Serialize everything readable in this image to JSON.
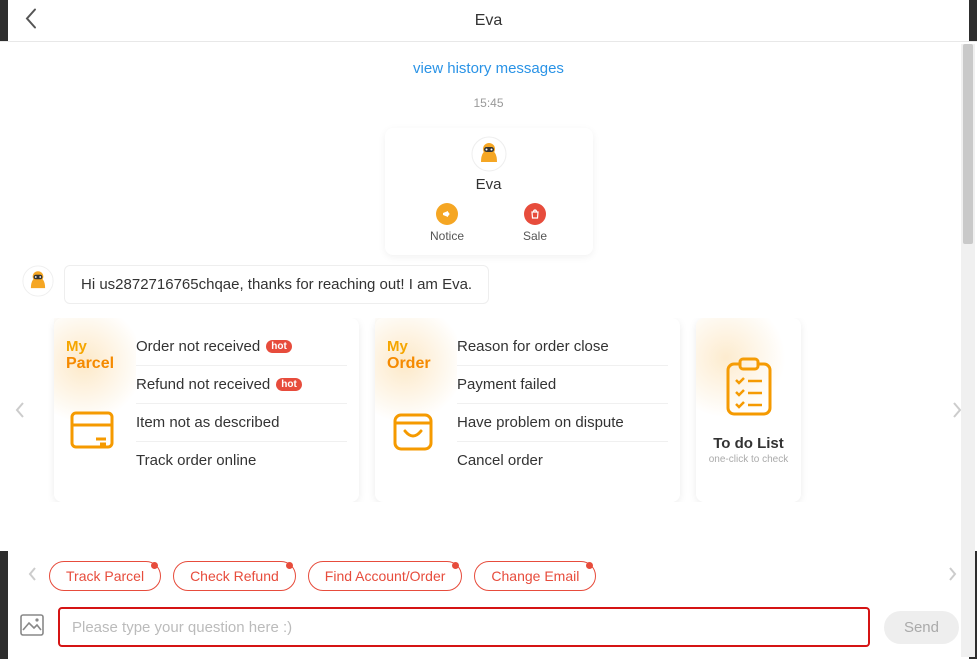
{
  "header": {
    "title": "Eva"
  },
  "history_link": "view history messages",
  "timestamp": "15:45",
  "bot": {
    "name": "Eva",
    "actions": [
      {
        "label": "Notice",
        "icon": "megaphone",
        "color": "orange"
      },
      {
        "label": "Sale",
        "icon": "bag",
        "color": "red"
      }
    ]
  },
  "greeting": "Hi us2872716765chqae, thanks for reaching out! I am Eva.",
  "help_cards": [
    {
      "category_line1": "My",
      "category_line2": "Parcel",
      "icon": "parcel-box",
      "items": [
        {
          "label": "Order not received",
          "hot": true
        },
        {
          "label": "Refund not received",
          "hot": true
        },
        {
          "label": "Item not as described",
          "hot": false
        },
        {
          "label": "Track order online",
          "hot": false
        }
      ]
    },
    {
      "category_line1": "My",
      "category_line2": "Order",
      "icon": "shopping-bag",
      "items": [
        {
          "label": "Reason for order close",
          "hot": false
        },
        {
          "label": "Payment failed",
          "hot": false
        },
        {
          "label": "Have problem on dispute",
          "hot": false
        },
        {
          "label": "Cancel order",
          "hot": false
        }
      ]
    }
  ],
  "todo_card": {
    "title": "To do List",
    "subtitle": "one-click to check",
    "icon": "checklist"
  },
  "suggestions": [
    "Track Parcel",
    "Check Refund",
    "Find Account/Order",
    "Change Email"
  ],
  "input": {
    "placeholder": "Please type your question here :)"
  },
  "send_label": "Send",
  "hot_badge": "hot"
}
